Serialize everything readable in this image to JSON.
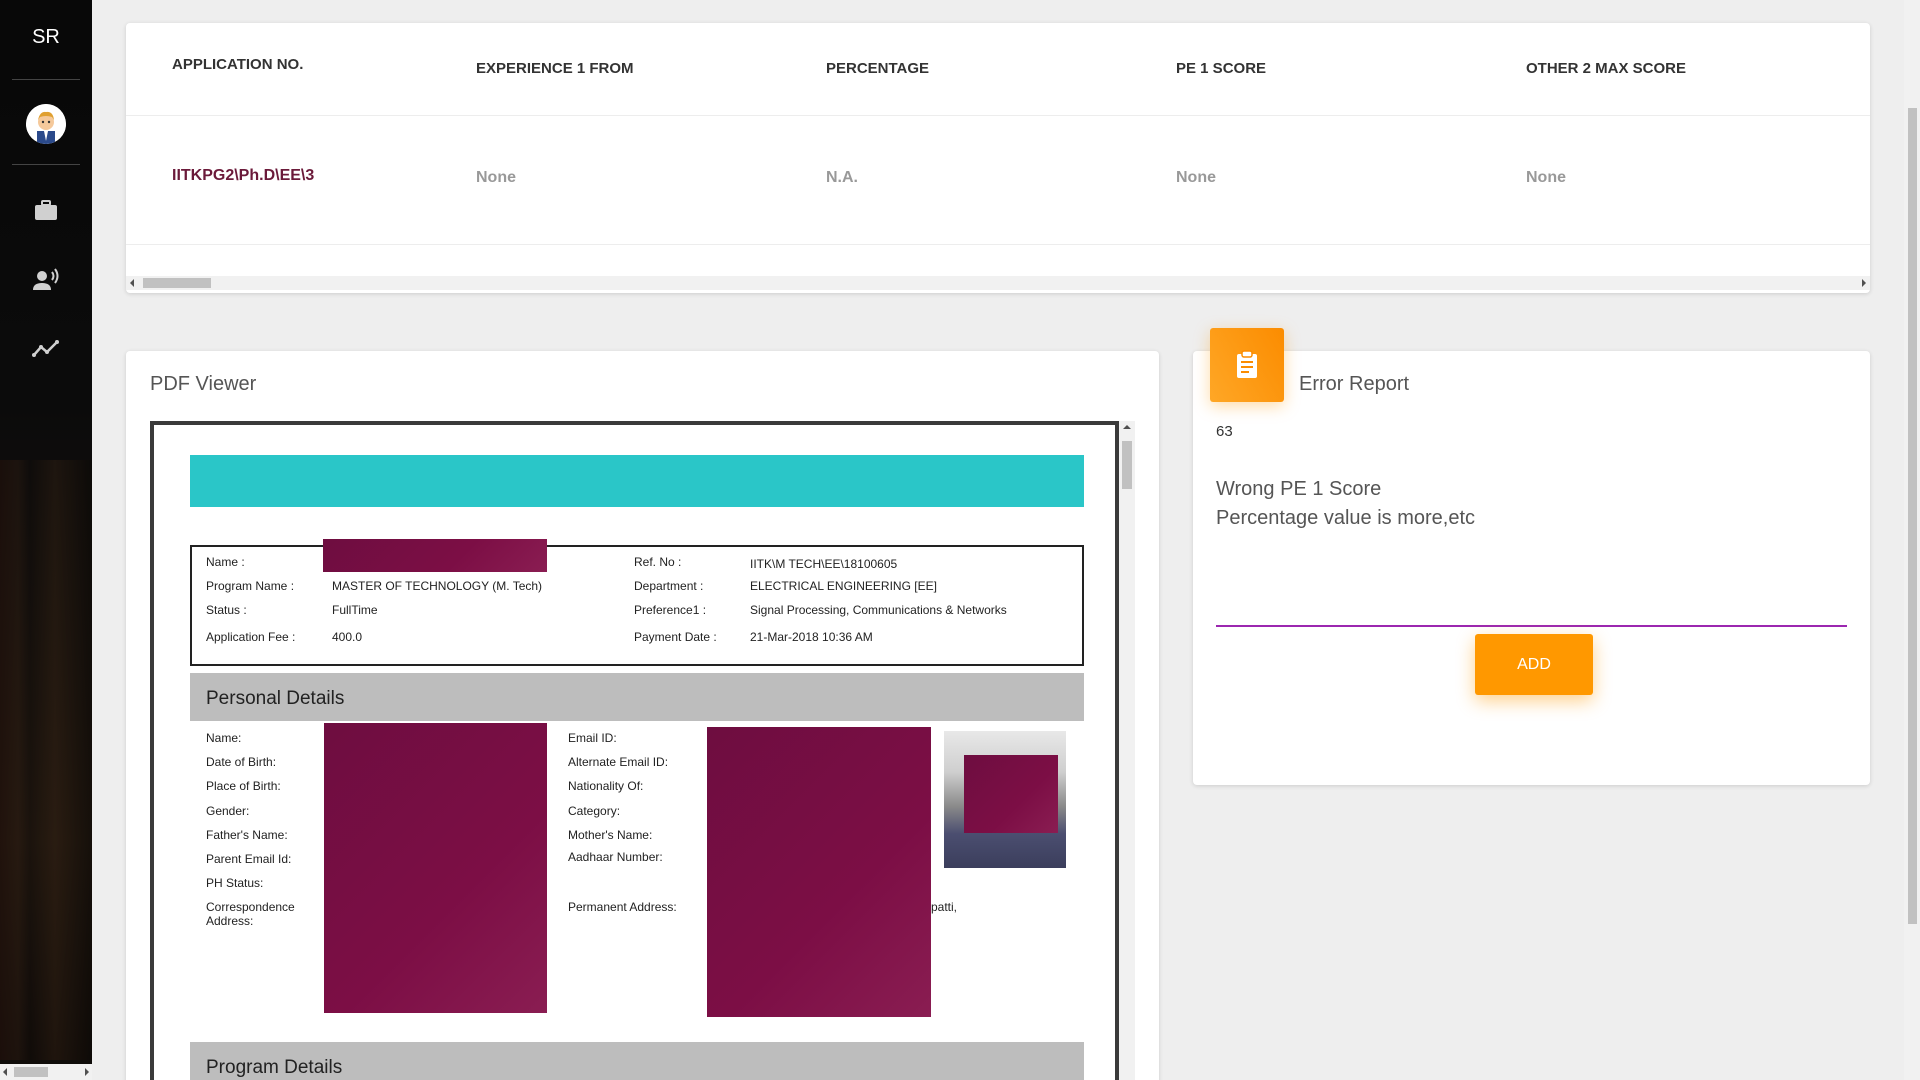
{
  "sidebar": {
    "logo": "SR",
    "nav_icons": [
      "briefcase-icon",
      "record-voice-icon",
      "timeline-icon"
    ]
  },
  "table": {
    "headers": [
      "APPLICATION NO.",
      "EXPERIENCE 1 FROM",
      "PERCENTAGE",
      "PE 1 SCORE",
      "OTHER 2 MAX SCORE"
    ],
    "row": [
      "IITKPG2\\Ph.D\\EE\\3",
      "None",
      "N.A.",
      "None",
      "None"
    ]
  },
  "pdf_viewer": {
    "title": "PDF Viewer",
    "info": {
      "name_label": "Name :",
      "program_label": "Program Name :",
      "program_value": "MASTER OF TECHNOLOGY (M. Tech)",
      "status_label": "Status :",
      "status_value": "FullTime",
      "fee_label": "Application Fee :",
      "fee_value": "400.0",
      "ref_label": "Ref. No :",
      "ref_value": "IITK\\M TECH\\EE\\18100605",
      "dept_label": "Department :",
      "dept_value": "ELECTRICAL ENGINEERING [EE]",
      "pref_label": "Preference1 :",
      "pref_value": "Signal Processing, Communications & Networks",
      "paydate_label": "Payment Date :",
      "paydate_value": "21-Mar-2018 10:36 AM"
    },
    "personal": {
      "heading": "Personal Details",
      "left_labels": [
        "Name:",
        "Date of Birth:",
        "Place of Birth:",
        "Gender:",
        "Father's Name:",
        "Parent Email Id:",
        "PH Status:",
        "Correspondence\nAddress:"
      ],
      "right_labels": [
        "Email ID:",
        "Alternate Email ID:",
        "Nationality Of:",
        "Category:",
        "Mother's Name:",
        "Aadhaar Number:",
        "Permanent Address:"
      ],
      "address_fragment": "patti,"
    },
    "program": {
      "heading": "Program Details"
    }
  },
  "error_report": {
    "title": "Error Report",
    "id": "63",
    "lines": [
      "Wrong PE 1 Score",
      "Percentage value is more,etc"
    ],
    "add_label": "ADD"
  },
  "colors": {
    "accent_orange": "#ff9800",
    "underline_purple": "#9c27b0",
    "teal_bar": "#2ac6c8",
    "redaction": "#7c0e45"
  }
}
